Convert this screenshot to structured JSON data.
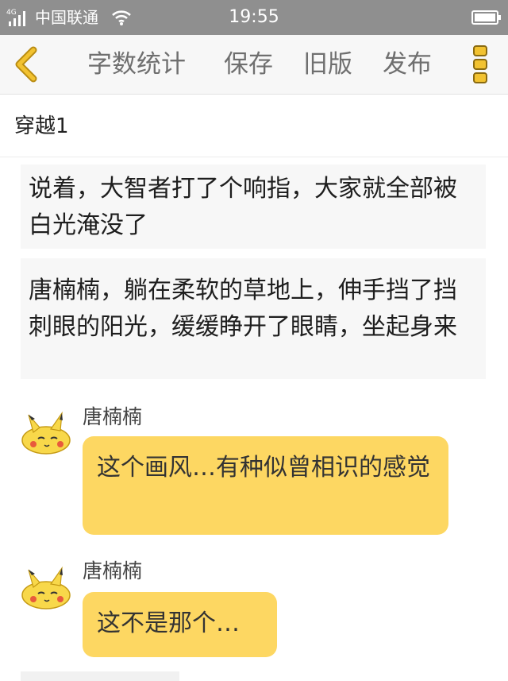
{
  "status_bar": {
    "network": "4G",
    "carrier": "中国联通",
    "time": "19:55"
  },
  "toolbar": {
    "back_icon": "chevron-left-icon",
    "word_count_label": "字数统计",
    "save_label": "保存",
    "old_version_label": "旧版",
    "publish_label": "发布",
    "more_icon": "more-vertical-icon",
    "accent_color": "#f2c230"
  },
  "chapter": {
    "title": "穿越1"
  },
  "narration": [
    {
      "text": "说着，大智者打了个响指，大家就全部被白光淹没了"
    },
    {
      "text": "唐楠楠，躺在柔软的草地上，伸手挡了挡刺眼的阳光，缓缓睁开了眼睛，坐起身来"
    }
  ],
  "messages": [
    {
      "speaker": "唐楠楠",
      "text": "这个画风…有种似曾相识的感觉",
      "avatar_icon": "pikachu-avatar"
    },
    {
      "speaker": "唐楠楠",
      "text": "这不是那个…",
      "avatar_icon": "pikachu-avatar"
    }
  ],
  "colors": {
    "bubble": "#fdd762",
    "narration_bg": "#f7f7f7",
    "status_bar": "#8f8f8f"
  }
}
